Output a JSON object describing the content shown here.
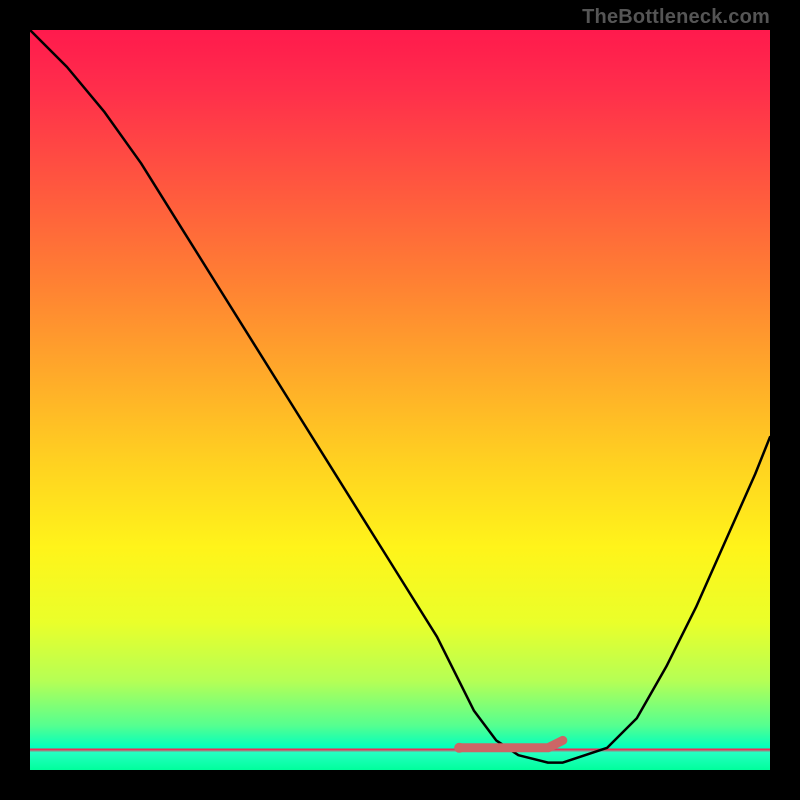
{
  "attribution": "TheBottleneck.com",
  "colors": {
    "frame": "#000000",
    "curve": "#000000",
    "marker": "#cc6666",
    "gradient_top": "#ff1a4d",
    "gradient_mid": "#fff41a",
    "gradient_bottom": "#00ff9c"
  },
  "chart_data": {
    "type": "line",
    "title": "",
    "xlabel": "",
    "ylabel": "",
    "xlim": [
      0,
      100
    ],
    "ylim": [
      0,
      100
    ],
    "series": [
      {
        "name": "bottleneck-curve",
        "x": [
          0,
          5,
          10,
          15,
          20,
          25,
          30,
          35,
          40,
          45,
          50,
          55,
          58,
          60,
          63,
          66,
          70,
          72,
          78,
          82,
          86,
          90,
          94,
          98,
          100
        ],
        "values": [
          100,
          95,
          89,
          82,
          74,
          66,
          58,
          50,
          42,
          34,
          26,
          18,
          12,
          8,
          4,
          2,
          1,
          1,
          3,
          7,
          14,
          22,
          31,
          40,
          45
        ]
      }
    ],
    "markers": {
      "name": "flat-zone-indicator",
      "x": [
        58,
        60,
        63,
        66,
        70,
        72
      ],
      "values": [
        3,
        3,
        3,
        3,
        3,
        4
      ],
      "color": "#cc6666"
    }
  }
}
